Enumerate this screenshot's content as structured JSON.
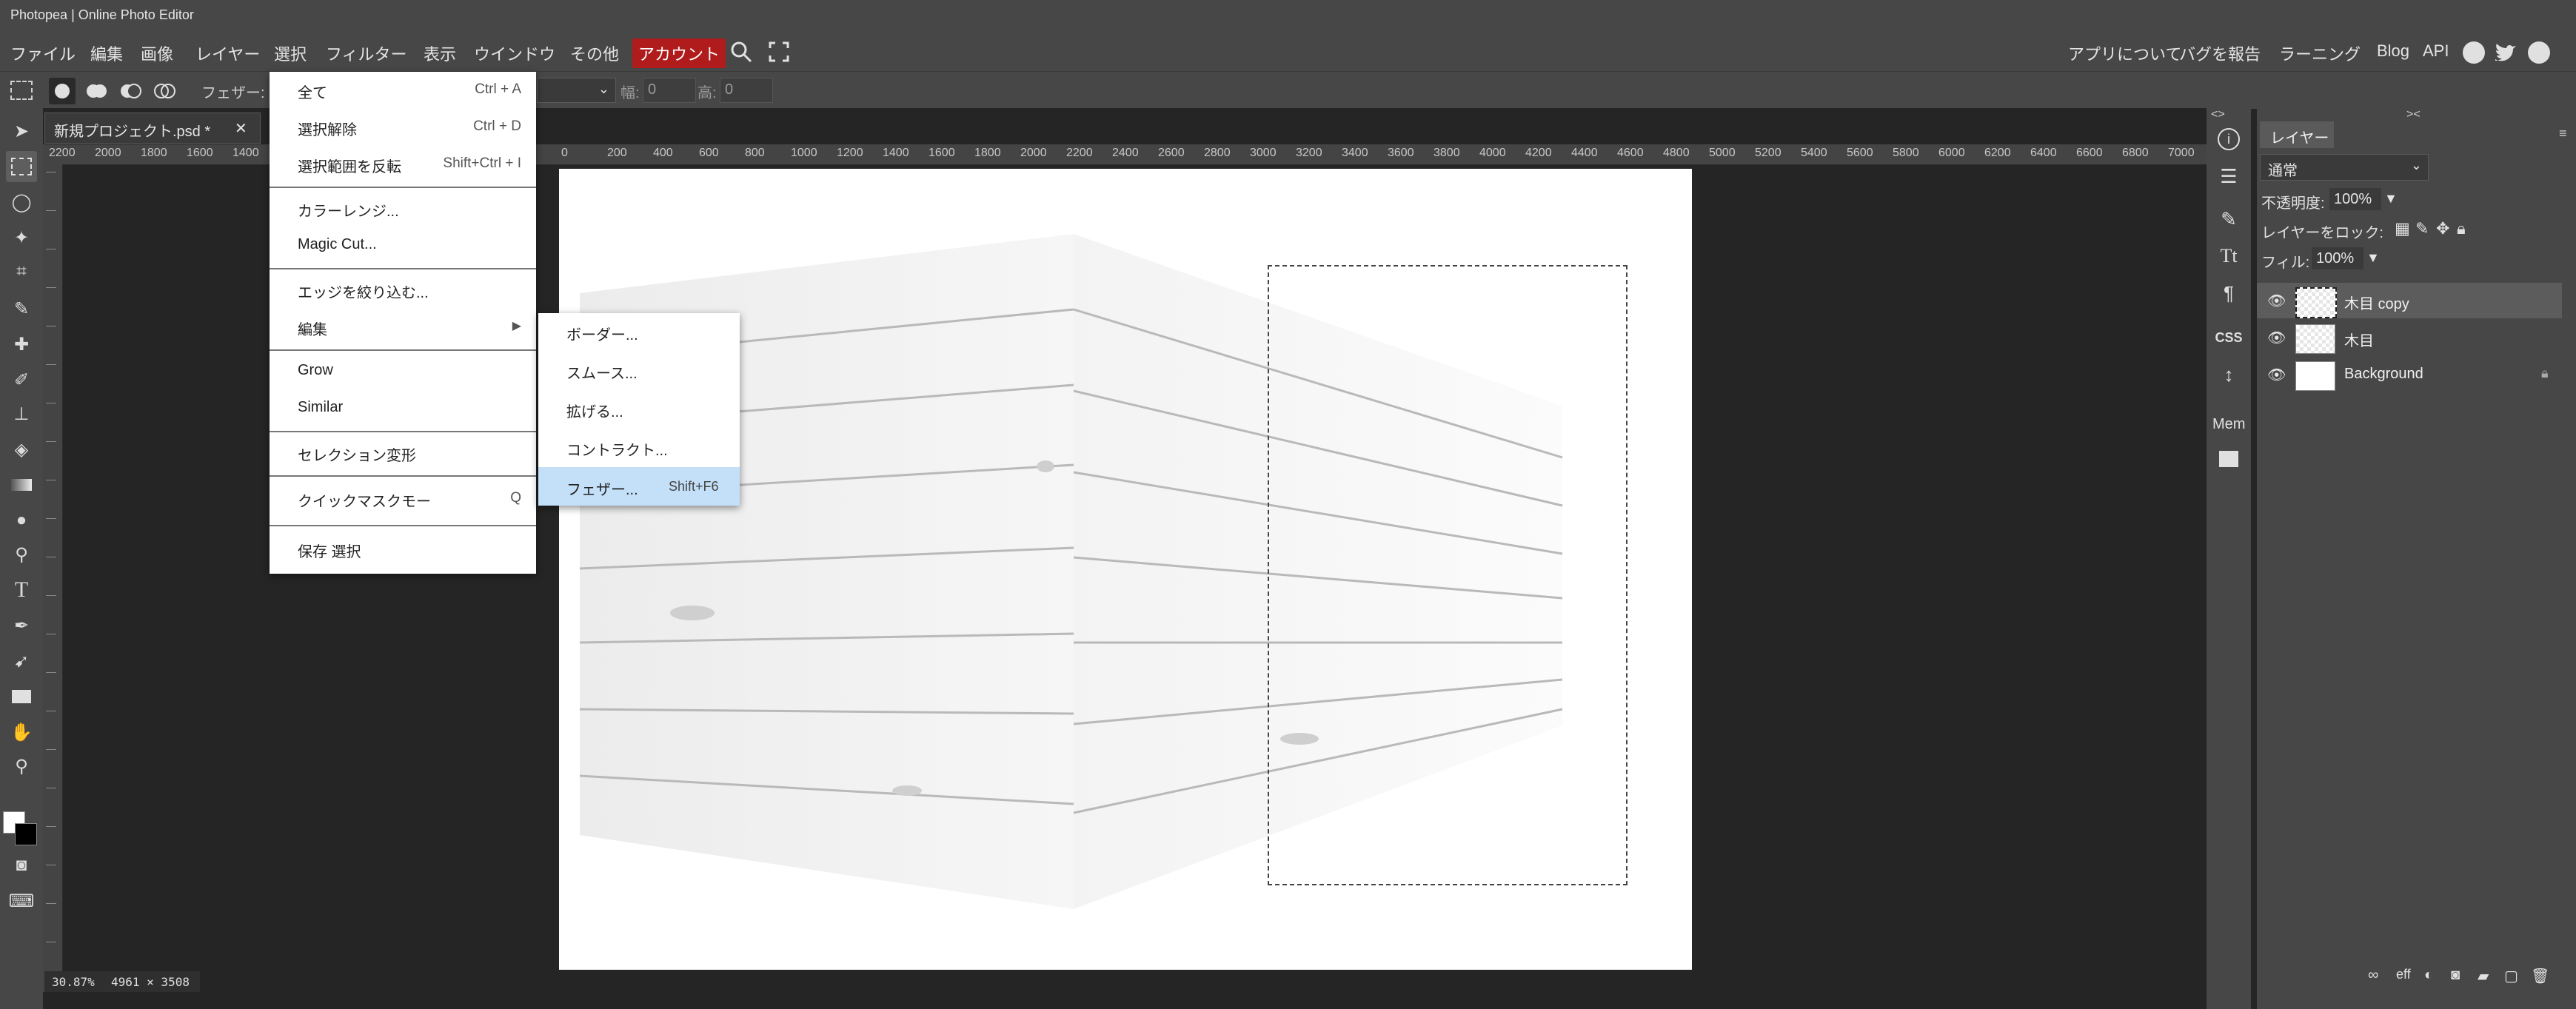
{
  "window": {
    "title": "Photopea | Online Photo Editor"
  },
  "menubar": {
    "items": [
      "ファイル",
      "編集",
      "画像",
      "レイヤー",
      "選択",
      "フィルター",
      "表示",
      "ウインドウ",
      "その他",
      "アカウント"
    ],
    "right_links": [
      "アプリについて",
      "バグを報告",
      "ラーニング",
      "Blog",
      "API"
    ]
  },
  "options": {
    "feather_label": "フェザー:",
    "width_label": "幅:",
    "width_value": "0",
    "height_label": "高:",
    "height_value": "0"
  },
  "document": {
    "tab_title": "新規プロジェクト.psd *",
    "close_glyph": "✕",
    "status_zoom": "30.87%",
    "status_size": "4961 × 3508",
    "ruler_labels": [
      "2200",
      "2000",
      "1800",
      "1600",
      "1400",
      "0",
      "200",
      "400",
      "600",
      "800",
      "1000",
      "1200",
      "1400",
      "1600",
      "1800",
      "2000",
      "2200",
      "2400",
      "2600",
      "2800",
      "3000",
      "3200",
      "3400",
      "3600",
      "3800",
      "4000",
      "4200",
      "4400",
      "4600",
      "4800",
      "5000",
      "5200",
      "5400",
      "5600",
      "5800",
      "6000",
      "6200",
      "6400",
      "6600",
      "6800",
      "7000"
    ]
  },
  "select_menu": {
    "items": [
      {
        "label": "全て",
        "shortcut": "Ctrl + A"
      },
      {
        "label": "選択解除",
        "shortcut": "Ctrl + D"
      },
      {
        "label": "選択範囲を反転",
        "shortcut": "Shift+Ctrl + I"
      },
      {
        "label": "カラーレンジ...",
        "shortcut": ""
      },
      {
        "label": "Magic Cut...",
        "shortcut": ""
      },
      {
        "label": "エッジを絞り込む...",
        "shortcut": ""
      },
      {
        "label": "編集",
        "shortcut": "▶"
      },
      {
        "label": "Grow",
        "shortcut": ""
      },
      {
        "label": "Similar",
        "shortcut": ""
      },
      {
        "label": "セレクション変形",
        "shortcut": ""
      },
      {
        "label": "クイックマスクモー",
        "shortcut": "Q"
      },
      {
        "label": "保存 選択",
        "shortcut": ""
      }
    ]
  },
  "edit_submenu": {
    "items": [
      {
        "label": "ボーダー...",
        "shortcut": ""
      },
      {
        "label": "スムース...",
        "shortcut": ""
      },
      {
        "label": "拡げる...",
        "shortcut": ""
      },
      {
        "label": "コントラクト...",
        "shortcut": ""
      },
      {
        "label": "フェザー...",
        "shortcut": "Shift+F6"
      }
    ]
  },
  "layers_panel": {
    "tab": "レイヤー",
    "blend_mode": "通常",
    "opacity_label": "不透明度:",
    "opacity_value": "100%",
    "lock_label": "レイヤーをロック:",
    "fill_label": "フィル:",
    "fill_value": "100%",
    "layers": [
      {
        "name": "木目 copy",
        "selected": true
      },
      {
        "name": "木目",
        "selected": false
      },
      {
        "name": "Background",
        "selected": false,
        "locked": true
      }
    ]
  },
  "icon_column": {
    "mem_label": "Mem",
    "css_label": "CSS"
  }
}
